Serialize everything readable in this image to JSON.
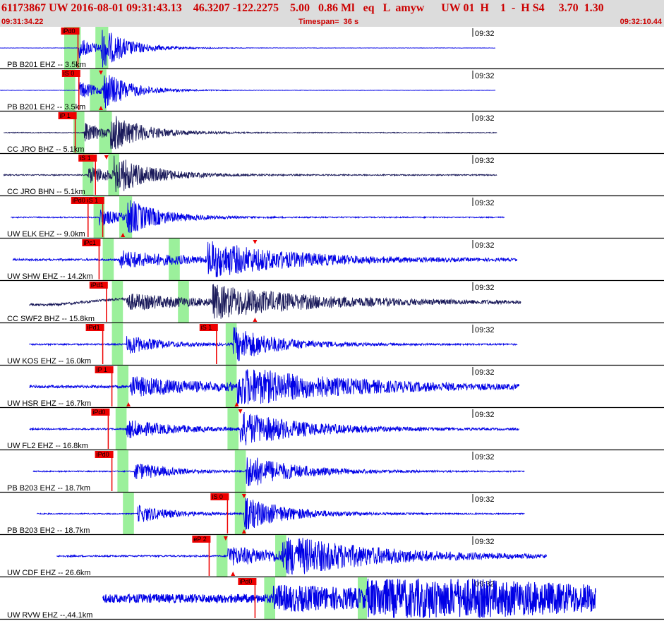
{
  "header": {
    "title": "61173867 UW 2016-08-01 09:31:43.13    46.3207 -122.2275    5.00   0.86 Ml   eq   L  amyw      UW 01  H    1  -  H S4     3.70  1.30",
    "start_time": "09:31:34.22",
    "timespan": "Timespan=  36 s",
    "end_time": "09:32:10.44"
  },
  "colors": {
    "background": "#ffffff",
    "header_bg": "#dcdcdc",
    "header_text": "#cc0000",
    "trace_blue": "#0000e6",
    "trace_dark": "#1a1a5a",
    "pick": "#ee0000",
    "window": "#90ee90"
  },
  "minute_mark": "09:32",
  "traces": [
    {
      "label": "PB B201 EHZ -- 3.5km",
      "color": "blue",
      "quiet": true,
      "windows": [
        [
          3.5,
          4.4
        ],
        [
          5.2,
          5.9
        ]
      ],
      "picks": [
        {
          "t": 4.25,
          "text": "iPd0",
          "flag": true
        }
      ],
      "triangles": [],
      "arrivals": [
        4.3,
        5.5
      ],
      "seg": [
        0,
        27
      ],
      "noise": 0.01,
      "amp": 0.95,
      "decay": 2.5
    },
    {
      "label": "PB B201 EH2 -- 3.5km",
      "color": "blue",
      "quiet": true,
      "windows": [
        [
          3.5,
          4.1
        ],
        [
          4.9,
          5.8
        ]
      ],
      "picks": [
        {
          "t": 4.3,
          "text": "iS 0",
          "flag": true
        }
      ],
      "triangles": [
        {
          "t": 4.2,
          "dir": "down"
        },
        {
          "t": 5.5,
          "dir": "down"
        },
        {
          "t": 5.5,
          "dir": "up"
        }
      ],
      "arrivals": [
        4.3,
        5.6
      ],
      "seg": [
        0,
        27
      ],
      "noise": 0.01,
      "amp": 0.9,
      "decay": 2.5
    },
    {
      "label": "CC JRO BHZ -- 5.1km",
      "color": "dark",
      "quiet": false,
      "windows": [
        [
          4.0,
          4.6
        ],
        [
          5.4,
          6.1
        ]
      ],
      "picks": [
        {
          "t": 4.1,
          "text": "iP 1",
          "flag": true
        }
      ],
      "triangles": [],
      "arrivals": [
        4.6,
        6.0
      ],
      "seg": [
        0.2,
        27.1
      ],
      "noise": 0.02,
      "amp": 0.9,
      "decay": 3
    },
    {
      "label": "CC JRO BHN -- 5.1km",
      "color": "dark",
      "quiet": false,
      "windows": [
        [
          4.5,
          5.1
        ],
        [
          5.9,
          6.5
        ]
      ],
      "picks": [
        {
          "t": 5.2,
          "text": "iS 1",
          "flag": true
        }
      ],
      "triangles": [
        {
          "t": 5.8,
          "dir": "down"
        }
      ],
      "arrivals": [
        4.8,
        6.2
      ],
      "seg": [
        0.2,
        27.1
      ],
      "noise": 0.03,
      "amp": 0.85,
      "decay": 3.5
    },
    {
      "label": "UW ELK EHZ -- 9.0km",
      "color": "blue",
      "quiet": false,
      "windows": [
        [
          5.1,
          5.7
        ],
        [
          6.5,
          7.2
        ]
      ],
      "picks": [
        {
          "t": 4.8,
          "text": "iPd0",
          "flag": true
        },
        {
          "t": 5.6,
          "text": "iS 1",
          "flag": true
        }
      ],
      "triangles": [
        {
          "t": 6.7,
          "dir": "up"
        }
      ],
      "arrivals": [
        5.4,
        6.9
      ],
      "seg": [
        0.6,
        27.5
      ],
      "noise": 0.03,
      "amp": 0.85,
      "decay": 3
    },
    {
      "label": "UW SHW EHZ -- 14.2km",
      "color": "blue",
      "quiet": false,
      "windows": [
        [
          5.6,
          6.2
        ],
        [
          9.2,
          9.8
        ]
      ],
      "picks": [
        {
          "t": 5.4,
          "text": "iPc1",
          "flag": true
        }
      ],
      "triangles": [
        {
          "t": 13.9,
          "dir": "down"
        }
      ],
      "arrivals": [
        6.5,
        11.3
      ],
      "seg": [
        0.7,
        28.2
      ],
      "noise": 0.05,
      "amp": 0.85,
      "decay": 8
    },
    {
      "label": "CC SWF2 BHZ -- 15.8km",
      "color": "dark",
      "quiet": false,
      "windows": [
        [
          6.1,
          6.7
        ],
        [
          9.7,
          10.3
        ]
      ],
      "picks": [
        {
          "t": 5.8,
          "text": "iPd1",
          "flag": true
        }
      ],
      "triangles": [
        {
          "t": 13.9,
          "dir": "up"
        }
      ],
      "arrivals": [
        6.9,
        11.6
      ],
      "seg": [
        1.6,
        28.4
      ],
      "noise": 0.06,
      "amp": 0.75,
      "decay": 9,
      "wobble": true
    },
    {
      "label": "UW KOS EHZ -- 16.0km",
      "color": "blue",
      "quiet": false,
      "windows": [
        [
          6.1,
          6.7
        ],
        [
          12.3,
          12.9
        ]
      ],
      "picks": [
        {
          "t": 5.6,
          "text": "iPd1",
          "flag": true
        },
        {
          "t": 11.8,
          "text": "iS 1",
          "flag": true
        }
      ],
      "triangles": [],
      "arrivals": [
        6.9,
        12.7
      ],
      "seg": [
        1.6,
        28.2
      ],
      "noise": 0.04,
      "amp": 0.9,
      "decay": 4
    },
    {
      "label": "UW HSR EHZ -- 16.7km",
      "color": "blue",
      "quiet": false,
      "windows": [
        [
          6.4,
          7.0
        ],
        [
          12.3,
          12.9
        ]
      ],
      "picks": [
        {
          "t": 6.1,
          "text": "iP 1",
          "flag": true
        }
      ],
      "triangles": [
        {
          "t": 7.0,
          "dir": "up"
        },
        {
          "t": 12.9,
          "dir": "up"
        }
      ],
      "arrivals": [
        7.1,
        12.9
      ],
      "seg": [
        1.6,
        28.3
      ],
      "noise": 0.07,
      "amp": 0.9,
      "decay": 10
    },
    {
      "label": "UW FL2 EHZ -- 16.8km",
      "color": "blue",
      "quiet": false,
      "windows": [
        [
          6.3,
          6.9
        ],
        [
          12.4,
          13.0
        ]
      ],
      "picks": [
        {
          "t": 5.9,
          "text": "iPd0",
          "flag": true
        }
      ],
      "triangles": [
        {
          "t": 13.1,
          "dir": "down"
        }
      ],
      "arrivals": [
        6.9,
        13.1
      ],
      "seg": [
        1.6,
        28.3
      ],
      "noise": 0.04,
      "amp": 0.85,
      "decay": 6
    },
    {
      "label": "PB B203 EHZ -- 18.7km",
      "color": "blue",
      "quiet": false,
      "windows": [
        [
          6.4,
          7.0
        ],
        [
          12.8,
          13.4
        ]
      ],
      "picks": [
        {
          "t": 6.1,
          "text": "iPd0",
          "flag": true
        }
      ],
      "triangles": [],
      "arrivals": [
        7.3,
        13.4
      ],
      "seg": [
        1.8,
        28.6
      ],
      "noise": 0.03,
      "amp": 0.85,
      "decay": 4.5
    },
    {
      "label": "PB B203 EH2 -- 18.7km",
      "color": "blue",
      "quiet": false,
      "windows": [
        [
          6.7,
          7.3
        ],
        [
          12.8,
          13.4
        ]
      ],
      "picks": [
        {
          "t": 12.4,
          "text": "iS 0",
          "flag": true
        }
      ],
      "triangles": [
        {
          "t": 13.3,
          "dir": "down"
        },
        {
          "t": 13.3,
          "dir": "up"
        }
      ],
      "arrivals": [
        7.5,
        13.3
      ],
      "seg": [
        2.0,
        28.6
      ],
      "noise": 0.03,
      "amp": 0.85,
      "decay": 4
    },
    {
      "label": "UW CDF EHZ -- 26.6km",
      "color": "blue",
      "quiet": false,
      "windows": [
        [
          11.8,
          12.4
        ],
        [
          15.0,
          15.6
        ]
      ],
      "picks": [
        {
          "t": 11.4,
          "text": "eP 2",
          "flag": true
        }
      ],
      "triangles": [
        {
          "t": 12.3,
          "dir": "down"
        },
        {
          "t": 12.7,
          "dir": "up"
        }
      ],
      "arrivals": [
        12.4,
        15.4
      ],
      "seg": [
        3.1,
        29.8
      ],
      "noise": 0.04,
      "amp": 0.9,
      "decay": 9
    },
    {
      "label": "UW RVW EHZ --,44.1km",
      "color": "blue",
      "quiet": false,
      "windows": [
        [
          14.4,
          15.0
        ],
        [
          19.5,
          20.0
        ]
      ],
      "picks": [
        {
          "t": 13.9,
          "text": "iPd0",
          "flag": true
        }
      ],
      "triangles": [],
      "arrivals": [
        14.9,
        20.0
      ],
      "seg": [
        5.6,
        32.5
      ],
      "noise": 0.22,
      "amp": 0.9,
      "decay": 25
    }
  ]
}
